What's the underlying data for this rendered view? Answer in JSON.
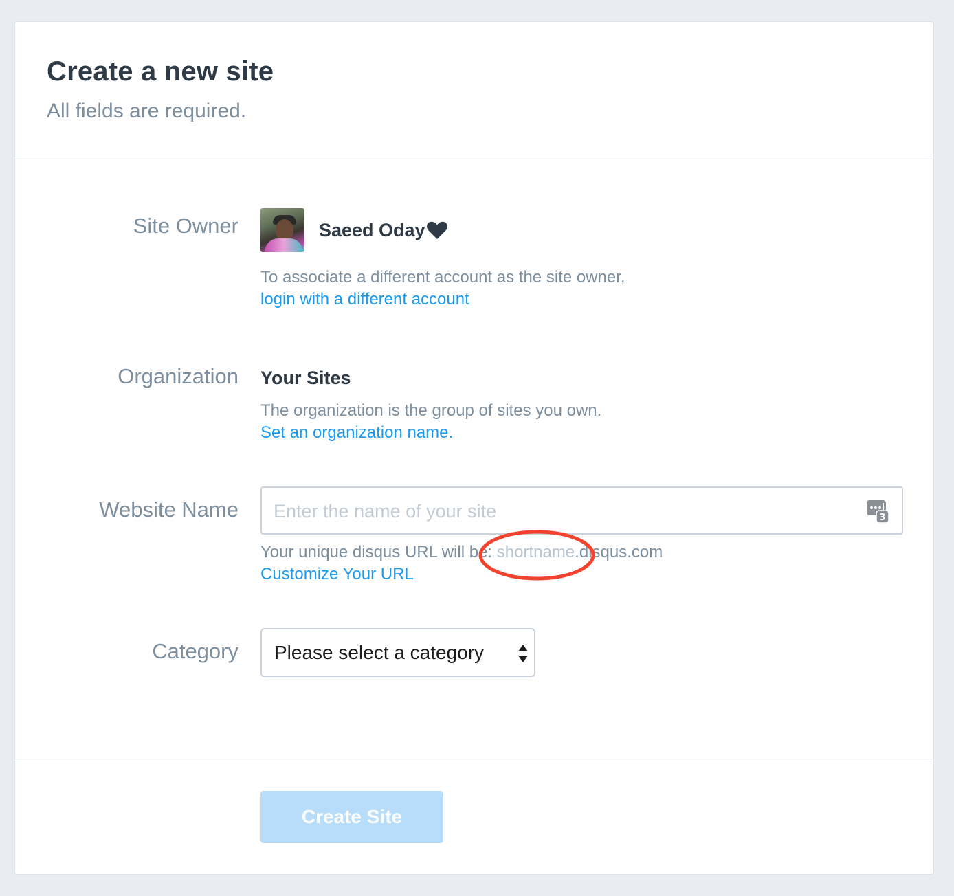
{
  "header": {
    "title": "Create a new site",
    "subtitle": "All fields are required."
  },
  "site_owner": {
    "label": "Site Owner",
    "name": "Saeed Oday",
    "help_text": "To associate a different account as the site owner,",
    "link_text": "login with a different account"
  },
  "organization": {
    "label": "Organization",
    "name": "Your Sites",
    "help_text": "The organization is the group of sites you own.",
    "link_text": "Set an organization name."
  },
  "website_name": {
    "label": "Website Name",
    "placeholder": "Enter the name of your site",
    "value": "",
    "url_prefix": "Your unique disqus URL will be: ",
    "url_shortname": "shortname",
    "url_suffix": ".disqus.com",
    "customize_link": "Customize Your URL",
    "password_manager_badge": "3"
  },
  "category": {
    "label": "Category",
    "selected": "Please select a category"
  },
  "footer": {
    "create_button": "Create Site"
  },
  "colors": {
    "background": "#e9edf1",
    "link": "#1a9bf0",
    "label": "#7d8f9e",
    "heading": "#2e3a45",
    "button_disabled": "#b7ddfb",
    "annotation": "#f2432f"
  },
  "icons": {
    "heart": "heart-icon",
    "password_manager": "password-manager-icon",
    "select_arrows": "select-arrows-icon"
  }
}
